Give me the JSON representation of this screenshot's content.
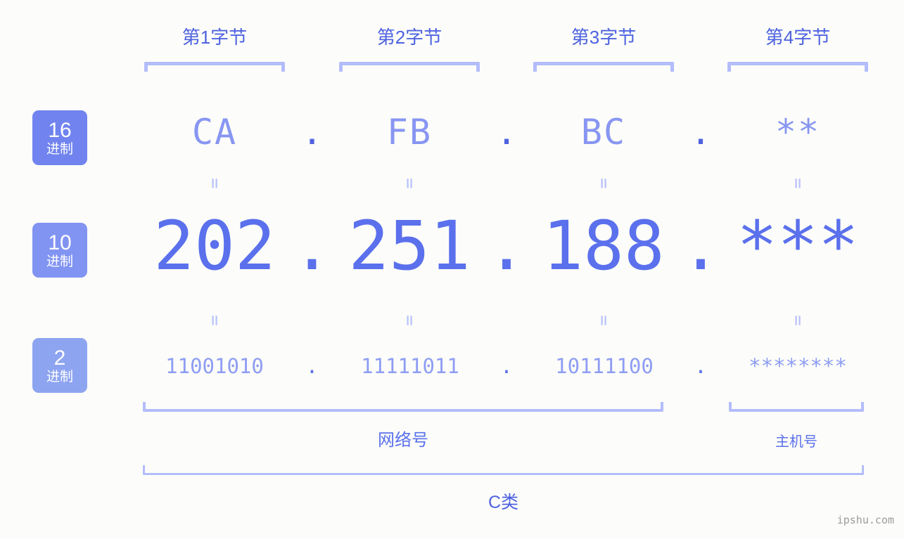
{
  "background_color": "#fcfdfa",
  "accent_colors": {
    "deep_blue": "#4e62e0",
    "primary_blue": "#5b70ec",
    "light_blue": "#8e9df3",
    "bracket_blue": "#b3bdfb",
    "badge_hex": "#7083ef",
    "badge_dec": "#8294f2",
    "badge_bin": "#8da4f0"
  },
  "byte_headers": [
    {
      "label": "第1字节"
    },
    {
      "label": "第2字节"
    },
    {
      "label": "第3字节"
    },
    {
      "label": "第4字节"
    }
  ],
  "base_badges": [
    {
      "number": "16",
      "unit": "进制"
    },
    {
      "number": "10",
      "unit": "进制"
    },
    {
      "number": "2",
      "unit": "进制"
    }
  ],
  "rows": {
    "hex": {
      "values": [
        "CA",
        "FB",
        "BC",
        "**"
      ],
      "separator": "."
    },
    "decimal": {
      "values": [
        "202",
        "251",
        "188",
        "***"
      ],
      "separator": "."
    },
    "binary": {
      "values": [
        "11001010",
        "11111011",
        "10111100",
        "********"
      ],
      "separator": "."
    }
  },
  "equals_symbol": "=",
  "sections": {
    "network_label": "网络号",
    "host_label": "主机号",
    "class_label": "C类"
  },
  "watermark": "ipshu.com"
}
